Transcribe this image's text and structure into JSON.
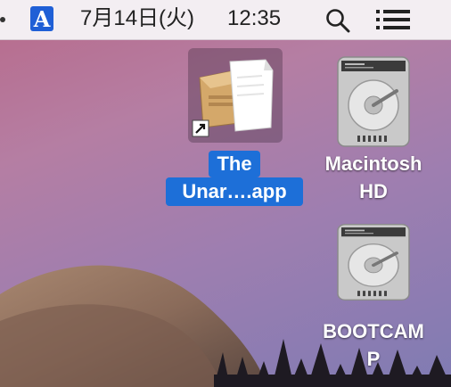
{
  "menubar": {
    "ime_label": "A",
    "date": "7月14日(火)",
    "time": "12:35",
    "spotlight_icon": "search-icon",
    "notification_icon": "list-icon"
  },
  "desktop": {
    "icons": [
      {
        "line1": "The",
        "line2": "Unar….app",
        "selected": true,
        "icon": "archive-app-alias-icon"
      },
      {
        "line1": "Macintosh",
        "line2": "HD",
        "selected": false,
        "icon": "hard-drive-icon"
      },
      {
        "line1": "BOOTCAM",
        "line2": "P",
        "selected": false,
        "icon": "hard-drive-icon"
      }
    ]
  },
  "colors": {
    "selection": "#1d6fd8",
    "menubar": "#f3eef2",
    "ime": "#1f5fd6"
  }
}
